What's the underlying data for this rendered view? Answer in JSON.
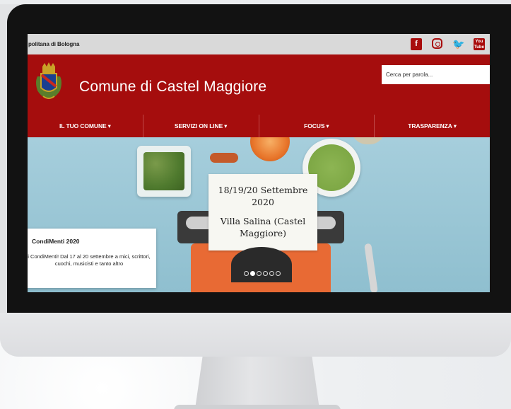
{
  "topbar": {
    "brand": "politana di Bologna"
  },
  "social": [
    "facebook-icon",
    "instagram-icon",
    "twitter-icon",
    "youtube-icon"
  ],
  "social_labels": {
    "facebook": "f",
    "youtube": "You Tube"
  },
  "header": {
    "title": "Comune di Castel Maggiore",
    "search_placeholder": "Cerca per parola..."
  },
  "nav": {
    "items": [
      {
        "label": "IL TUO COMUNE",
        "caret": "▾"
      },
      {
        "label": "SERVIZI ON LINE",
        "caret": "▾"
      },
      {
        "label": "FOCUS",
        "caret": "▾"
      },
      {
        "label": "TRASPARENZA",
        "caret": "▾"
      }
    ]
  },
  "hero": {
    "paper_dates": "18/19/20 Settembre 2020",
    "paper_place": "Villa Salina (Castel Maggiore)",
    "caption_title": "CondiMenti 2020",
    "caption_text": "i CondiMenti! Dal 17 al 20 settembre a mici, scrittori, cuochi, musicisti e tanto altro",
    "slide_count": 6,
    "active_slide": 2
  },
  "colors": {
    "brand_red": "#a50d0d",
    "topbar_gray": "#d9d9d9",
    "bezel": "#121212"
  }
}
